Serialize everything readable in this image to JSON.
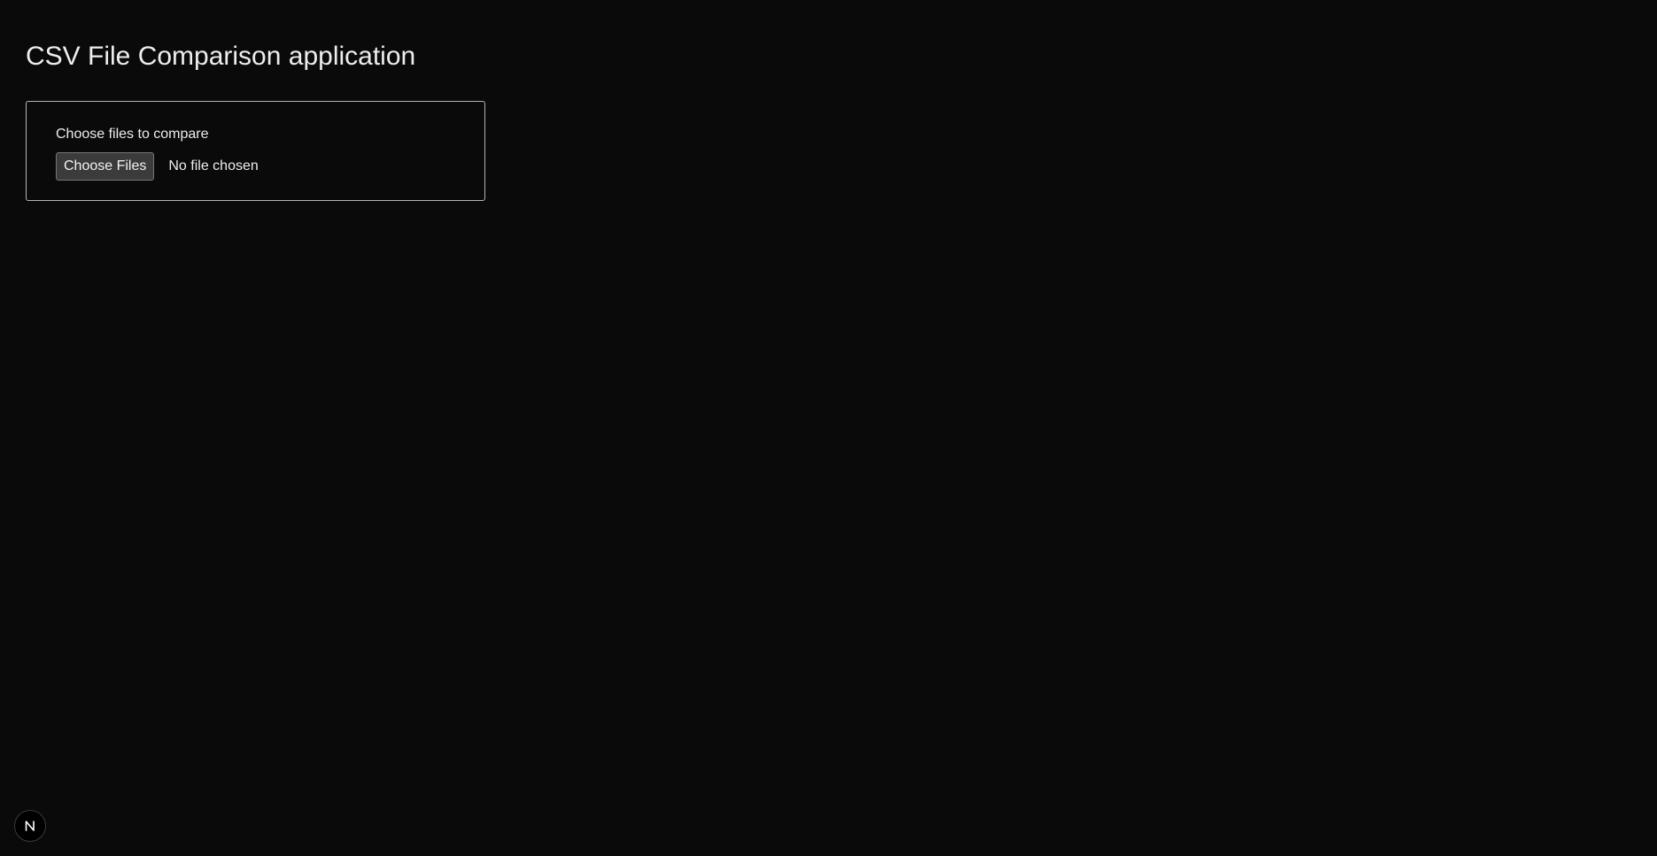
{
  "page": {
    "title": "CSV File Comparison application"
  },
  "upload": {
    "label": "Choose files to compare",
    "button_label": "Choose Files",
    "status": "No file chosen"
  },
  "dev_indicator": {
    "icon": "nextjs-logo-icon",
    "letter": "N"
  },
  "colors": {
    "background": "#0a0a0a",
    "text": "#ededed",
    "card_border": "#b5b5b5",
    "button_bg": "#3b3b3b"
  }
}
